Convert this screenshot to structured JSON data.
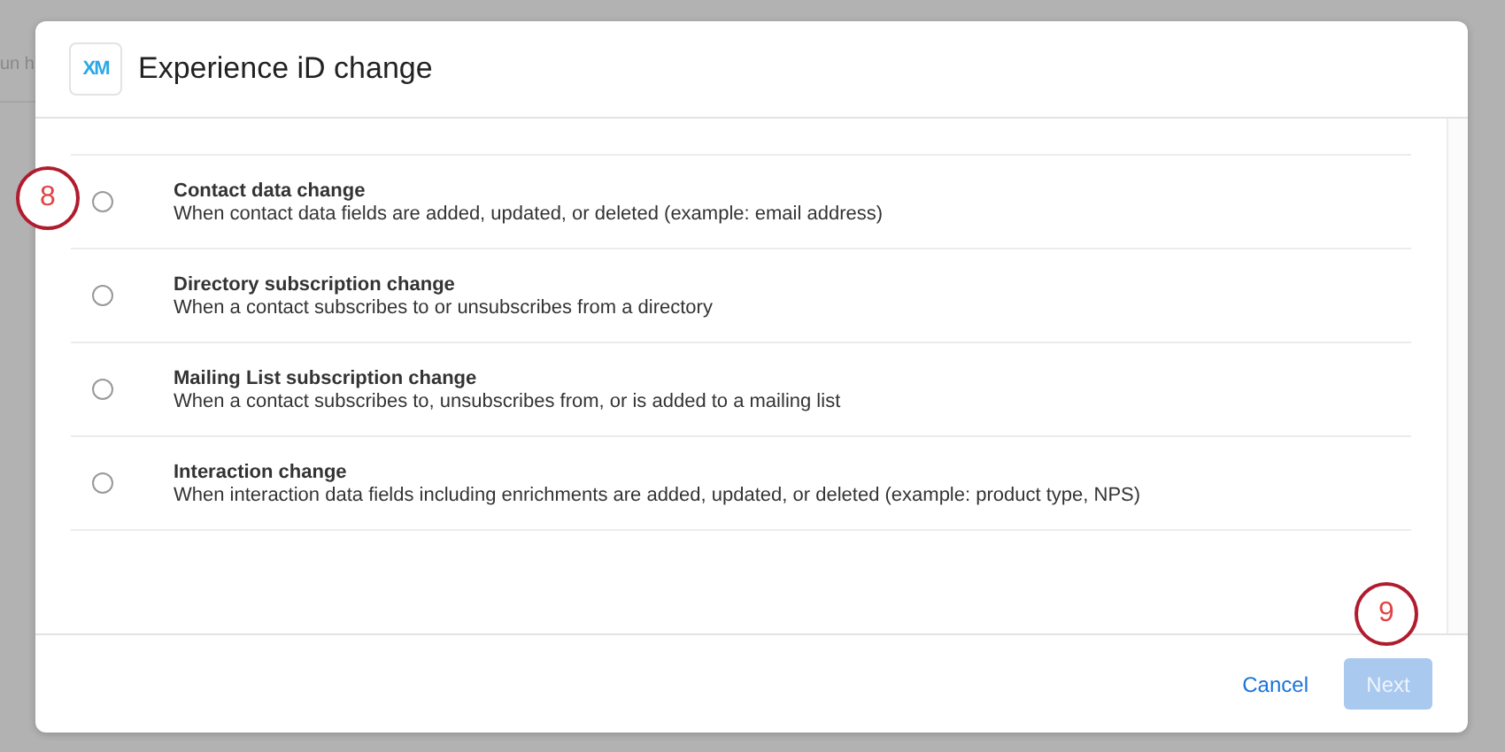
{
  "background": {
    "text": "un h"
  },
  "dialog": {
    "title": "Experience iD change",
    "logo": "XM"
  },
  "options": [
    {
      "title": "Contact data change",
      "description": "When contact data fields are added, updated, or deleted (example: email address)",
      "selected": false
    },
    {
      "title": "Directory subscription change",
      "description": "When a contact subscribes to or unsubscribes from a directory",
      "selected": false
    },
    {
      "title": "Mailing List subscription change",
      "description": "When a contact subscribes to, unsubscribes from, or is added to a mailing list",
      "selected": false
    },
    {
      "title": "Interaction change",
      "description": "When interaction data fields including enrichments are added, updated, or deleted (example: product type, NPS)",
      "selected": false
    }
  ],
  "buttons": [
    {
      "label": "Cancel",
      "kind": "link",
      "disabled": false
    },
    {
      "label": "Next",
      "kind": "primary",
      "disabled": true
    }
  ],
  "callouts": [
    {
      "number": "8"
    },
    {
      "number": "9"
    }
  ]
}
